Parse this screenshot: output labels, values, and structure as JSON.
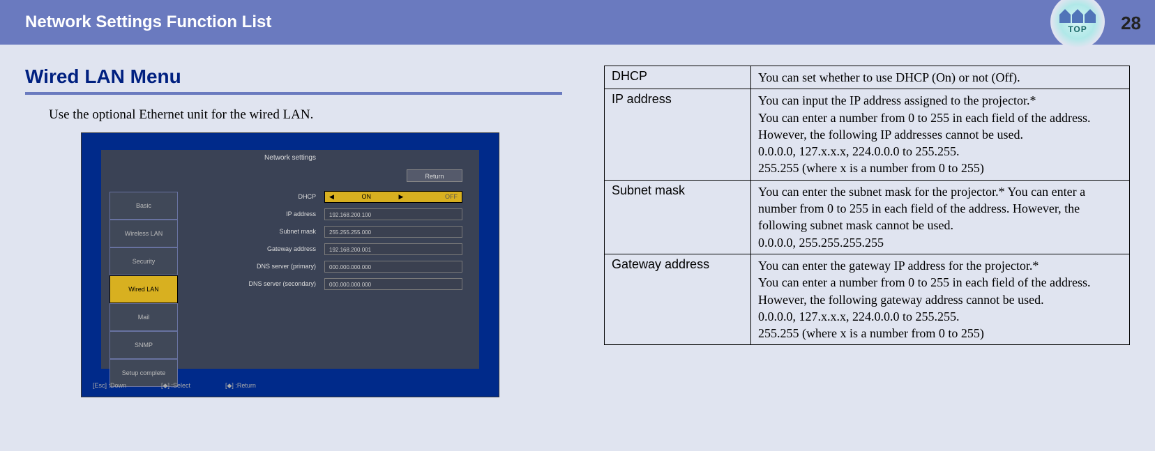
{
  "header": {
    "title": "Network Settings Function List",
    "top_label": "TOP",
    "page_number": "28"
  },
  "section": {
    "title": "Wired LAN Menu",
    "intro": "Use the optional Ethernet unit for the wired LAN."
  },
  "screenshot": {
    "window_title": "Network settings",
    "return_btn": "Return",
    "tabs": [
      "Basic",
      "Wireless LAN",
      "Security",
      "Wired LAN",
      "Mail",
      "SNMP",
      "Setup complete"
    ],
    "active_tab_index": 3,
    "fields": [
      {
        "label": "DHCP",
        "type": "toggle",
        "value": "ON",
        "off": "OFF"
      },
      {
        "label": "IP address",
        "type": "text",
        "value": "192.168.200.100"
      },
      {
        "label": "Subnet mask",
        "type": "text",
        "value": "255.255.255.000"
      },
      {
        "label": "Gateway address",
        "type": "text",
        "value": "192.168.200.001"
      },
      {
        "label": "DNS server (primary)",
        "type": "text",
        "value": "000.000.000.000"
      },
      {
        "label": "DNS server (secondary)",
        "type": "text",
        "value": "000.000.000.000"
      }
    ],
    "footer": [
      "[Esc] :Down",
      "[◆] :Select",
      "[◆] :Return"
    ]
  },
  "table": {
    "rows": [
      {
        "name": "DHCP",
        "desc": "You can set whether to use DHCP (On) or not (Off)."
      },
      {
        "name": "IP address",
        "desc": "You can input the IP address assigned to the projector.*\nYou can enter a number from 0 to 255 in each field of the address. However, the following IP addresses cannot be used.\n0.0.0.0, 127.x.x.x, 224.0.0.0 to 255.255.\n255.255 (where x is a number from 0 to 255)"
      },
      {
        "name": "Subnet mask",
        "desc": "You can enter the subnet mask for the projector.* You can enter a number from 0 to 255 in each field of the address. However, the following subnet mask cannot be used.\n0.0.0.0, 255.255.255.255"
      },
      {
        "name": "Gateway address",
        "desc": "You can enter the gateway IP address for the projector.*\nYou can enter a number from 0 to 255 in each field of the address. However, the following gateway address cannot be used.\n0.0.0.0, 127.x.x.x, 224.0.0.0 to 255.255.\n255.255 (where x is a number from 0 to 255)"
      }
    ]
  }
}
